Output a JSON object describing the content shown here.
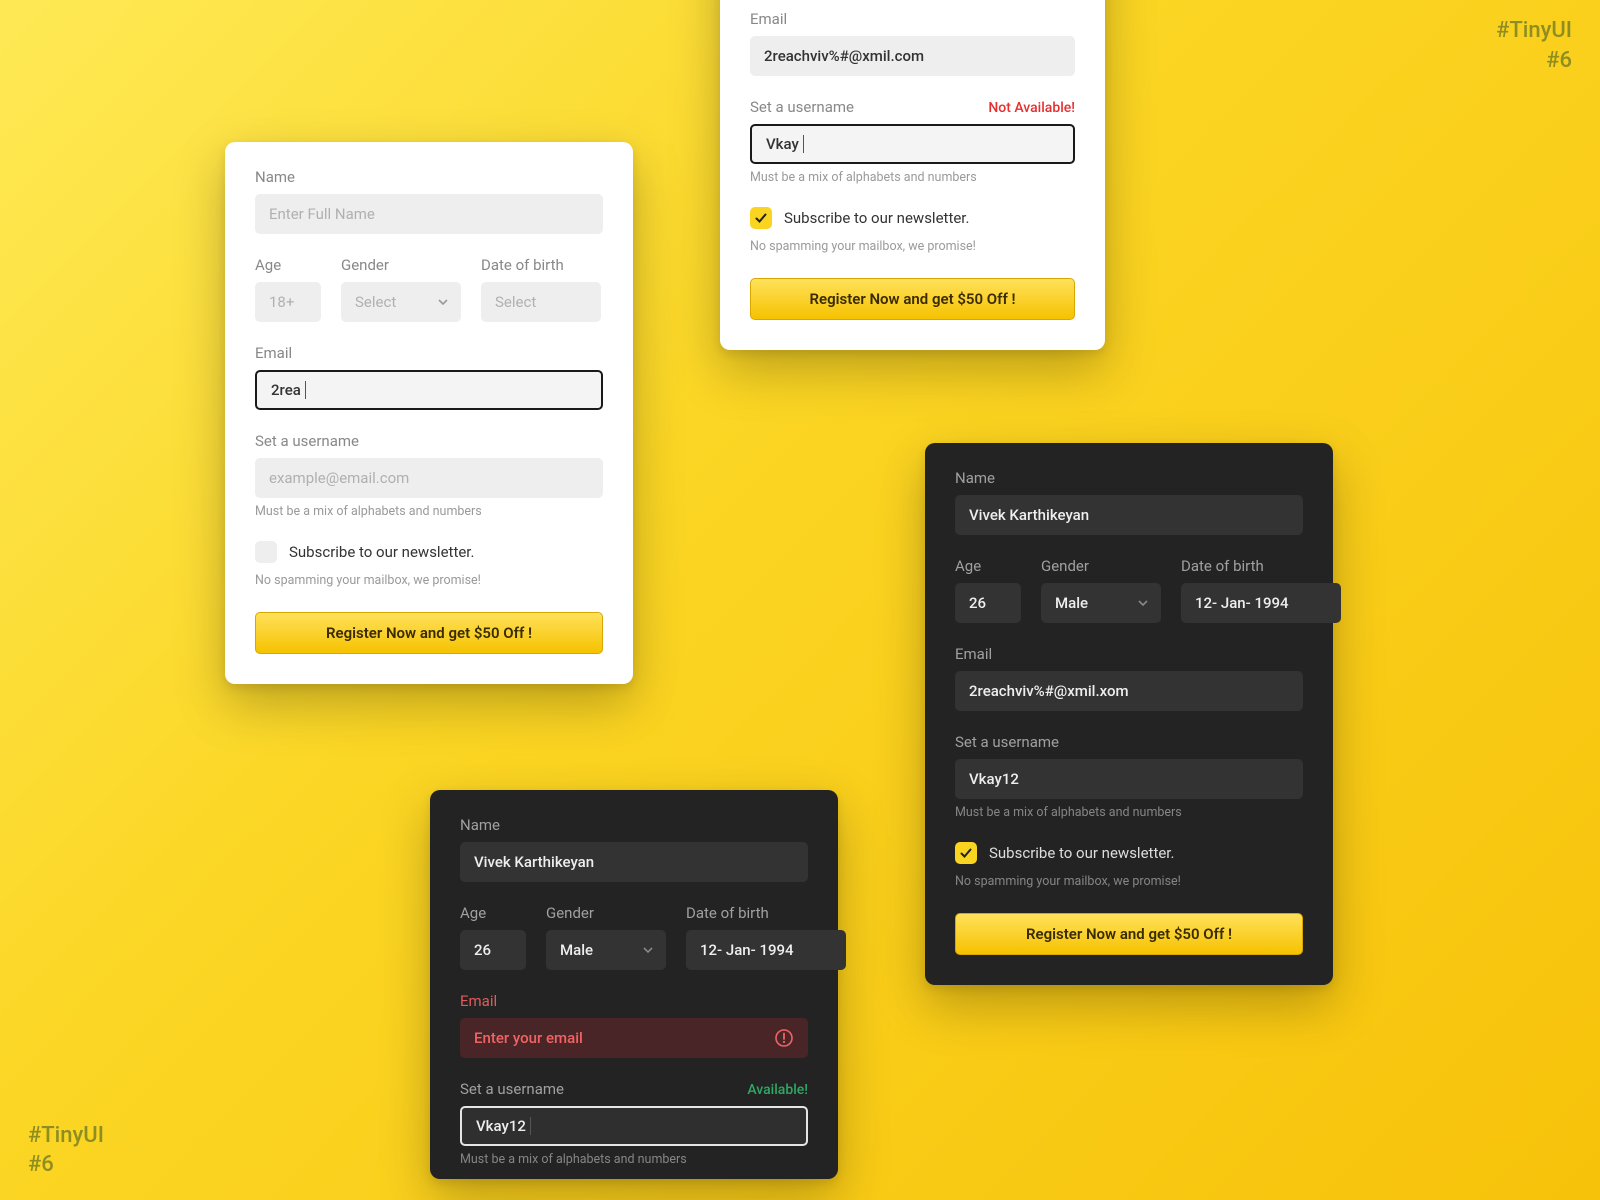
{
  "watermark": {
    "l1": "#TinyUI",
    "l2": "#6"
  },
  "labels": {
    "name": "Name",
    "age": "Age",
    "gender": "Gender",
    "dob": "Date of birth",
    "email": "Email",
    "username": "Set a username"
  },
  "placeholders": {
    "name": "Enter Full Name",
    "age": "18+",
    "select": "Select",
    "username_example": "example@email.com",
    "email_error": "Enter your email"
  },
  "helper": {
    "username": "Must be a mix of alphabets and numbers",
    "newsletter": "No spamming your mailbox, we promise!"
  },
  "newsletter_label": "Subscribe to our newsletter.",
  "button": "Register Now and get $50 Off !",
  "status": {
    "not_available": "Not Available!",
    "available": "Available!"
  },
  "card1": {
    "email_value": "2rea"
  },
  "card2": {
    "email_value": "2reachviv%#@xmil.com",
    "username_value": "Vkay"
  },
  "card3": {
    "name": "Vivek Karthikeyan",
    "age": "26",
    "gender": "Male",
    "dob": "12- Jan- 1994",
    "email": "2reachviv%#@xmil.xom",
    "username": "Vkay12"
  },
  "card4": {
    "name": "Vivek Karthikeyan",
    "age": "26",
    "gender": "Male",
    "dob": "12- Jan- 1994",
    "username": "Vkay12"
  }
}
